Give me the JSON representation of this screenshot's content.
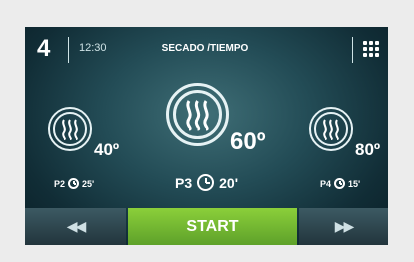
{
  "header": {
    "program_number": "4",
    "clock": "12:30",
    "title": "SECADO /TIEMPO"
  },
  "programs": [
    {
      "id": "p2",
      "label": "P2",
      "temperature": "40º",
      "time": "25'"
    },
    {
      "id": "p3",
      "label": "P3",
      "temperature": "60º",
      "time": "20'"
    },
    {
      "id": "p4",
      "label": "P4",
      "temperature": "80º",
      "time": "15'"
    }
  ],
  "footer": {
    "prev_label": "◀◀",
    "start_label": "START",
    "next_label": "▶▶"
  },
  "icons": {
    "menu": "grid-icon",
    "program": "heat-waves-icon",
    "timer": "clock-icon"
  },
  "colors": {
    "start": "#7cc035",
    "screen_bg": "#1e4650"
  }
}
